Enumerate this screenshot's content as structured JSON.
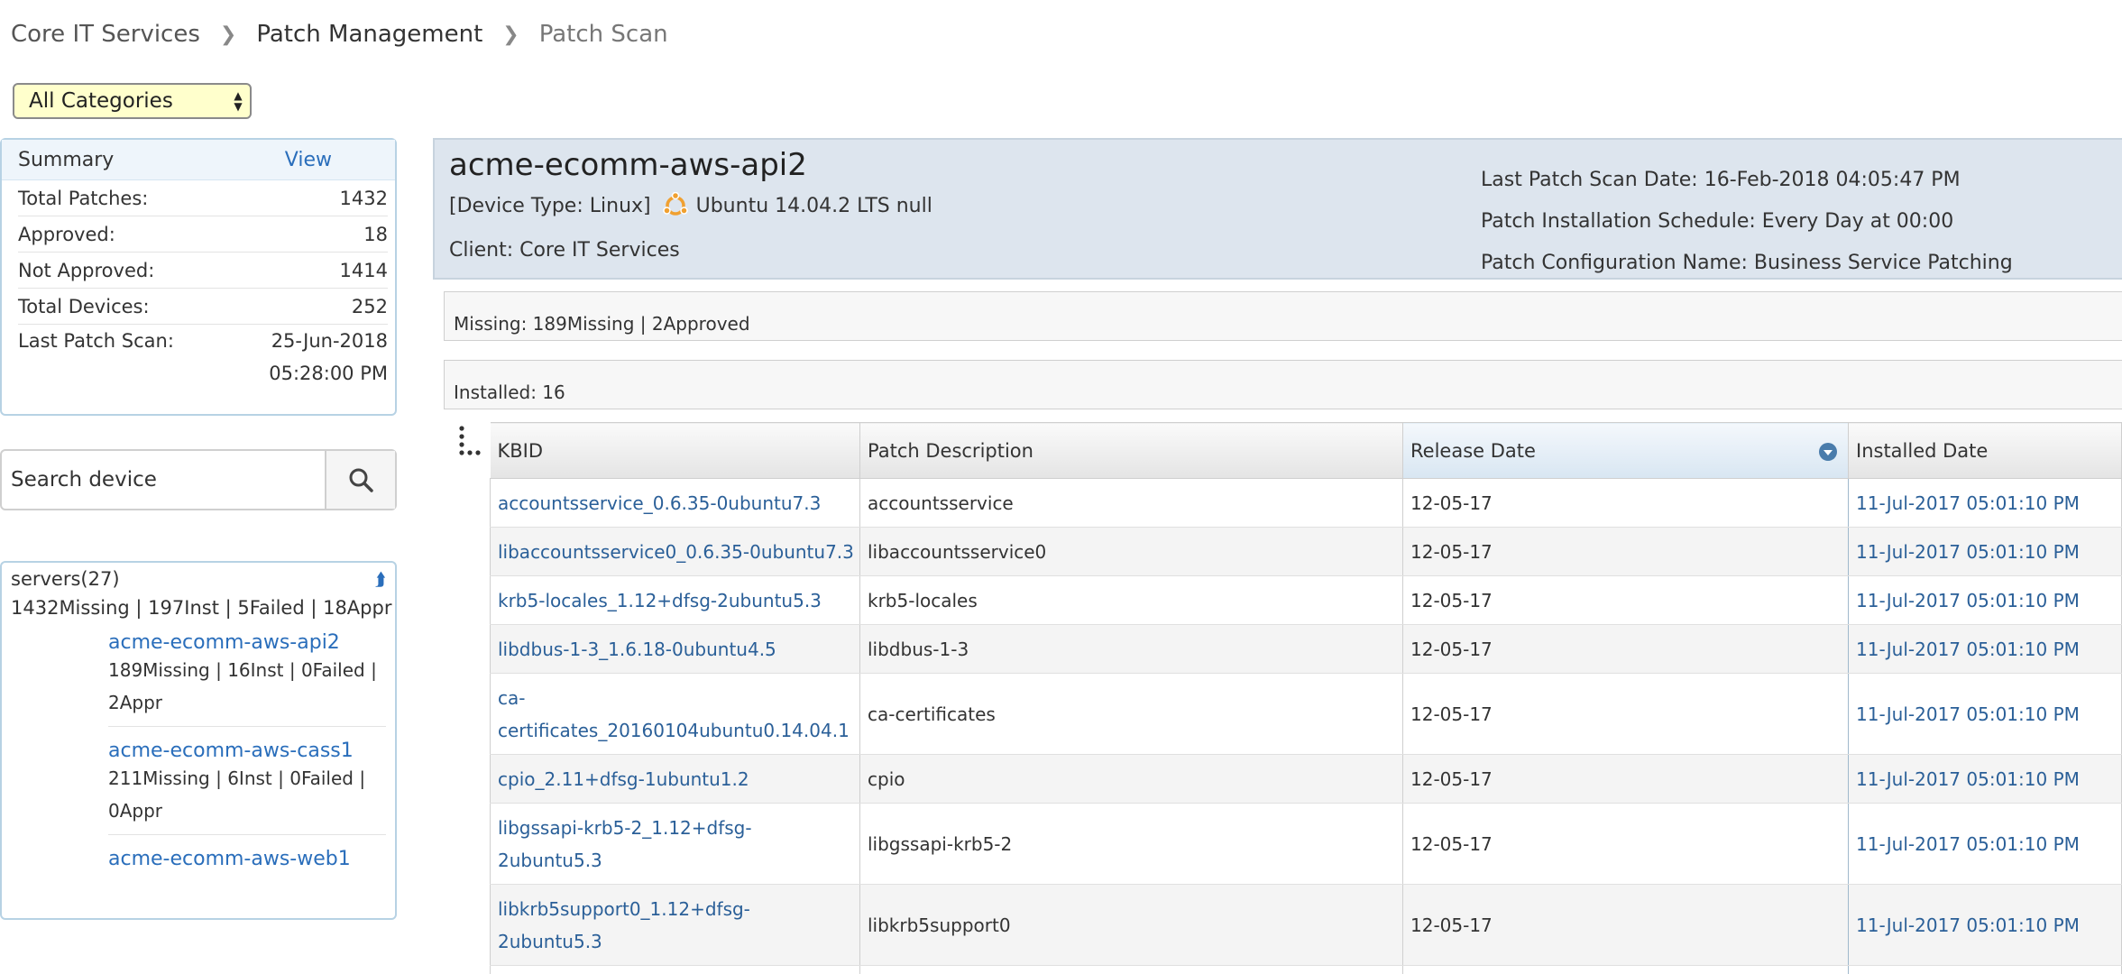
{
  "breadcrumb": [
    "Core IT Services",
    "Patch Management",
    "Patch Scan"
  ],
  "category_select": {
    "value": "All Categories"
  },
  "summary": {
    "title": "Summary",
    "view_link": "View",
    "rows": [
      {
        "label": "Total Patches:",
        "value": "1432"
      },
      {
        "label": "Approved:",
        "value": "18"
      },
      {
        "label": "Not Approved:",
        "value": "1414"
      },
      {
        "label": "Total Devices:",
        "value": "252"
      }
    ],
    "last_scan": {
      "label": "Last Patch Scan:",
      "date": "25-Jun-2018",
      "time": "05:28:00 PM"
    }
  },
  "search": {
    "placeholder": "Search device",
    "icon": "search-icon"
  },
  "servers": {
    "group_label": "servers(27)",
    "group_stats": "1432Missing | 197Inst | 5Failed | 18Appr",
    "devices": [
      {
        "name": "acme-ecomm-aws-api2",
        "stats_line1": "189Missing | 16Inst | 0Failed |",
        "stats_line2": "2Appr"
      },
      {
        "name": "acme-ecomm-aws-cass1",
        "stats_line1": "211Missing | 6Inst | 0Failed |",
        "stats_line2": "0Appr"
      },
      {
        "name": "acme-ecomm-aws-web1",
        "stats_line1": "",
        "stats_line2": ""
      }
    ]
  },
  "device": {
    "name": "acme-ecomm-aws-api2",
    "type_prefix": "[Device Type: Linux]",
    "os": "Ubuntu 14.04.2 LTS null",
    "client": "Client: Core IT Services",
    "last_scan": "Last Patch Scan Date: 16-Feb-2018 04:05:47 PM",
    "schedule": "Patch Installation Schedule: Every Day at 00:00",
    "config": "Patch Configuration Name: Business Service Patching"
  },
  "missing_bar": "Missing: 189Missing |  2Approved",
  "installed_bar": "Installed: 16",
  "table": {
    "headers": [
      "KBID",
      "Patch Description",
      "Release Date",
      "Installed Date"
    ],
    "rows": [
      {
        "kbid": "accountsservice_0.6.35-0ubuntu7.3",
        "desc": "accountsservice",
        "release": "12-05-17",
        "installed": "11-Jul-2017 05:01:10 PM"
      },
      {
        "kbid": "libaccountsservice0_0.6.35-0ubuntu7.3",
        "desc": "libaccountsservice0",
        "release": "12-05-17",
        "installed": "11-Jul-2017 05:01:10 PM"
      },
      {
        "kbid": "krb5-locales_1.12+dfsg-2ubuntu5.3",
        "desc": "krb5-locales",
        "release": "12-05-17",
        "installed": "11-Jul-2017 05:01:10 PM"
      },
      {
        "kbid": "libdbus-1-3_1.6.18-0ubuntu4.5",
        "desc": "libdbus-1-3",
        "release": "12-05-17",
        "installed": "11-Jul-2017 05:01:10 PM"
      },
      {
        "kbid_line1": "ca-",
        "kbid_line2": "certificates_20160104ubuntu0.14.04.1",
        "desc": "ca-certificates",
        "release": "12-05-17",
        "installed": "11-Jul-2017 05:01:10 PM"
      },
      {
        "kbid": "cpio_2.11+dfsg-1ubuntu1.2",
        "desc": "cpio",
        "release": "12-05-17",
        "installed": "11-Jul-2017 05:01:10 PM"
      },
      {
        "kbid_line1": "libgssapi-krb5-2_1.12+dfsg-",
        "kbid_line2": "2ubuntu5.3",
        "desc": "libgssapi-krb5-2",
        "release": "12-05-17",
        "installed": "11-Jul-2017 05:01:10 PM"
      },
      {
        "kbid_line1": "libkrb5support0_1.12+dfsg-",
        "kbid_line2": "2ubuntu5.3",
        "desc": "libkrb5support0",
        "release": "12-05-17",
        "installed": "11-Jul-2017 05:01:10 PM"
      }
    ]
  },
  "colors": {
    "link": "#2a6ebb",
    "panel_header": "#dde5ee",
    "select_bg": "#ffffcc",
    "ubuntu_orange": "#f0a030"
  }
}
